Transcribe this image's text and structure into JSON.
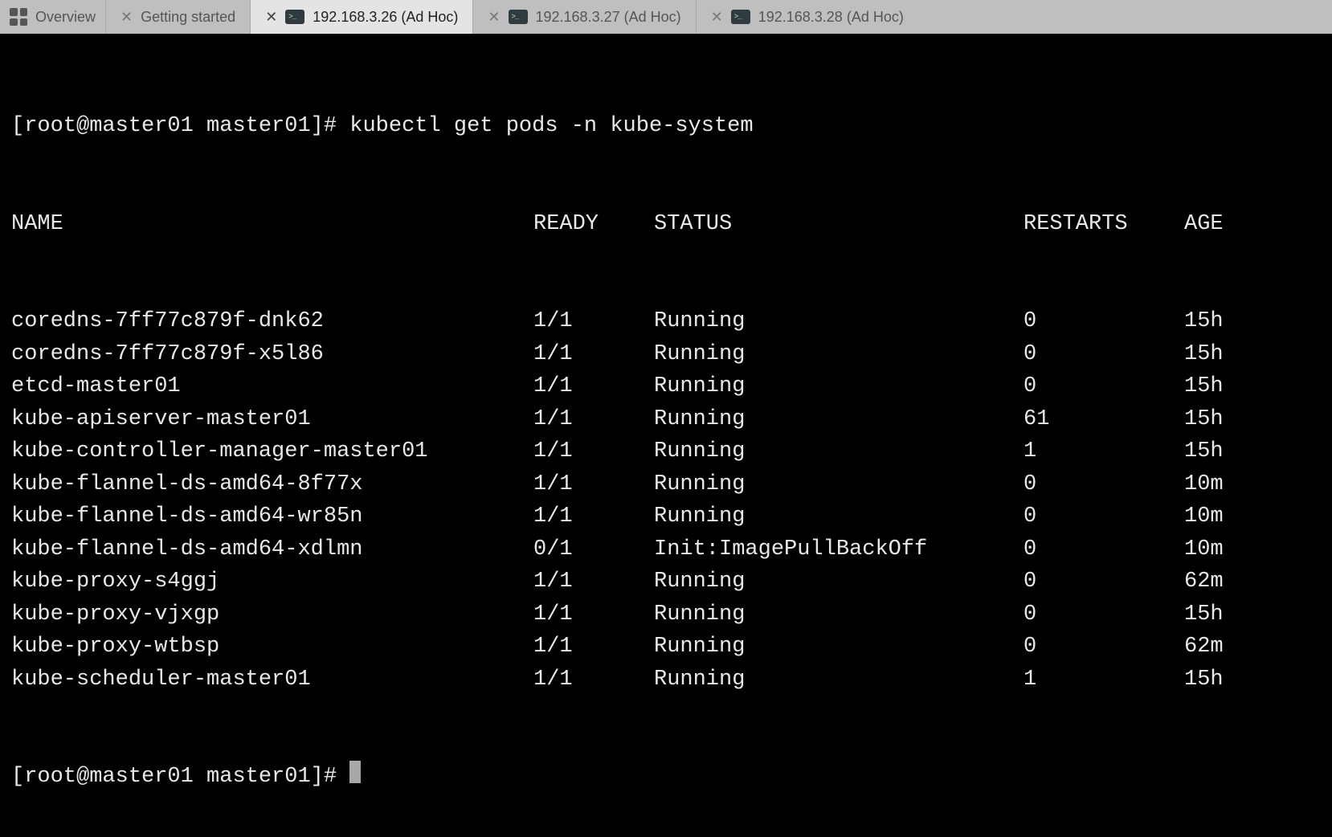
{
  "tabs": {
    "overview_label": "Overview",
    "items": [
      {
        "label": "Getting started",
        "has_icon": false
      },
      {
        "label": "192.168.3.26 (Ad Hoc)",
        "has_icon": true,
        "active": true
      },
      {
        "label": "192.168.3.27 (Ad Hoc)",
        "has_icon": true
      },
      {
        "label": "192.168.3.28 (Ad Hoc)",
        "has_icon": true
      }
    ]
  },
  "terminal": {
    "prompt": "[root@master01 master01]# ",
    "command": "kubectl get pods -n kube-system",
    "headers": {
      "name": "NAME",
      "ready": "READY",
      "status": "STATUS",
      "restarts": "RESTARTS",
      "age": "AGE"
    },
    "rows": [
      {
        "name": "coredns-7ff77c879f-dnk62",
        "ready": "1/1",
        "status": "Running",
        "restarts": "0",
        "age": "15h"
      },
      {
        "name": "coredns-7ff77c879f-x5l86",
        "ready": "1/1",
        "status": "Running",
        "restarts": "0",
        "age": "15h"
      },
      {
        "name": "etcd-master01",
        "ready": "1/1",
        "status": "Running",
        "restarts": "0",
        "age": "15h"
      },
      {
        "name": "kube-apiserver-master01",
        "ready": "1/1",
        "status": "Running",
        "restarts": "61",
        "age": "15h"
      },
      {
        "name": "kube-controller-manager-master01",
        "ready": "1/1",
        "status": "Running",
        "restarts": "1",
        "age": "15h"
      },
      {
        "name": "kube-flannel-ds-amd64-8f77x",
        "ready": "1/1",
        "status": "Running",
        "restarts": "0",
        "age": "10m"
      },
      {
        "name": "kube-flannel-ds-amd64-wr85n",
        "ready": "1/1",
        "status": "Running",
        "restarts": "0",
        "age": "10m"
      },
      {
        "name": "kube-flannel-ds-amd64-xdlmn",
        "ready": "0/1",
        "status": "Init:ImagePullBackOff",
        "restarts": "0",
        "age": "10m"
      },
      {
        "name": "kube-proxy-s4ggj",
        "ready": "1/1",
        "status": "Running",
        "restarts": "0",
        "age": "62m"
      },
      {
        "name": "kube-proxy-vjxgp",
        "ready": "1/1",
        "status": "Running",
        "restarts": "0",
        "age": "15h"
      },
      {
        "name": "kube-proxy-wtbsp",
        "ready": "1/1",
        "status": "Running",
        "restarts": "0",
        "age": "62m"
      },
      {
        "name": "kube-scheduler-master01",
        "ready": "1/1",
        "status": "Running",
        "restarts": "1",
        "age": "15h"
      }
    ],
    "prompt2": "[root@master01 master01]# "
  }
}
